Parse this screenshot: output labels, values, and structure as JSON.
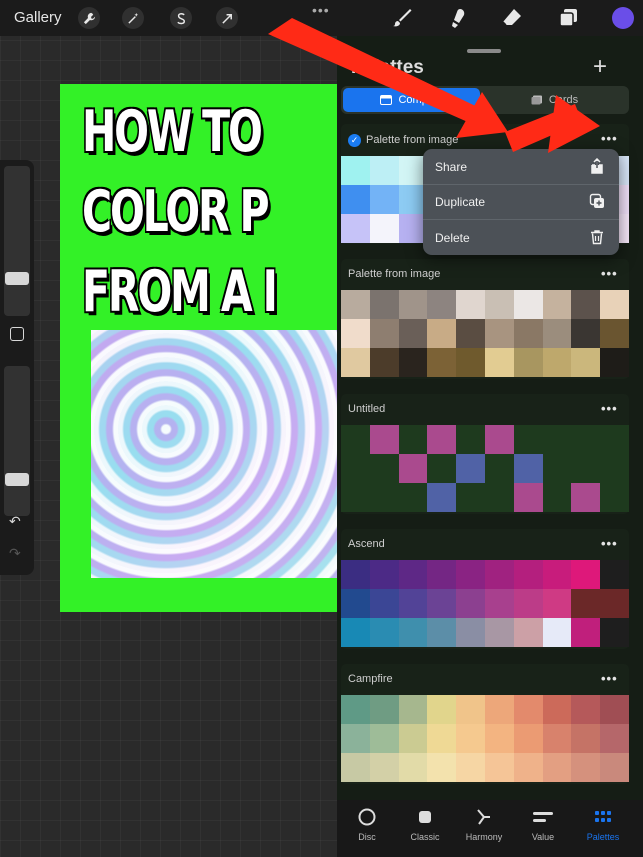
{
  "topbar": {
    "gallery_label": "Gallery",
    "tools": [
      "wrench-icon",
      "magic-wand-icon",
      "selection-icon",
      "transform-arrow-icon"
    ],
    "right_tools": [
      "brush-icon",
      "smudge-icon",
      "eraser-icon",
      "layers-icon",
      "color-swatch"
    ],
    "more_label": "•••",
    "active_color": "#6a4ee8"
  },
  "canvas": {
    "background_color": "#33f127",
    "headline_lines": [
      "HOW TO",
      "COLOR P",
      "FROM A I"
    ]
  },
  "panel": {
    "title": "Palettes",
    "add_label": "+",
    "segments": {
      "compact_label": "Compact",
      "cards_label": "Cards",
      "selected": "Compact"
    },
    "more_label": "•••",
    "palettes": [
      {
        "name": "Palette from image",
        "is_default": true,
        "default_mark": "✓",
        "swatches": [
          "#9ff2f0",
          "#bdeff5",
          "#d2f5f5",
          "#e2f4f7",
          "#f3f6f8",
          "#e9e9f7",
          "#d9d6f3",
          "#ccc9f1",
          "#c5c6f5",
          "#d8e6f8",
          "#3f8ff0",
          "#73b3f6",
          "#8dcbf3",
          "#a8d3f4",
          "#b8c6f1",
          "#c6b7ef",
          "#d2b7f0",
          "#e1c1f1",
          "#e4c8f3",
          "#f0dff8",
          "#c6c3f8",
          "#f4f4fb",
          "#b6b1f1",
          "#a4a7ed",
          "#a7b8f0",
          "#c2c6f2",
          "#d4c2f2",
          "#e6cdf4",
          "#eed7f5",
          "#f6e6f9"
        ]
      },
      {
        "name": "Palette from image",
        "is_default": false,
        "swatches": [
          "#b8ab9e",
          "#7b736e",
          "#a0948a",
          "#8d8480",
          "#e0d6cf",
          "#c9bfb4",
          "#ebe7e5",
          "#c5b29e",
          "#5c524c",
          "#e8d2b8",
          "#f0dccb",
          "#8e7e70",
          "#6a5f58",
          "#c8ab86",
          "#5a4d42",
          "#a89480",
          "#8a7865",
          "#9b8d7d",
          "#3a3632",
          "#6a5530",
          "#e0c9a0",
          "#4c3c2a",
          "#2a241e",
          "#7c6236",
          "#6f5a2d",
          "#e2cc92",
          "#a89660",
          "#bea86c",
          "#cbb77c",
          "#1e1c18"
        ]
      },
      {
        "name": "Untitled",
        "is_default": false,
        "swatches": [
          "#1e3a1e",
          "#aa4a8e",
          "#1e3a1e",
          "#aa4a8e",
          "#1e3a1e",
          "#aa4a8e",
          "#1e3a1e",
          "#1e3a1e",
          "#1e3a1e",
          "#1e3a1e",
          "#1e3a1e",
          "#1e3a1e",
          "#aa4a8e",
          "#1e3a1e",
          "#5062a6",
          "#1e3a1e",
          "#5062a6",
          "#1e3a1e",
          "#1e3a1e",
          "#1e3a1e",
          "#1e3a1e",
          "#1e3a1e",
          "#1e3a1e",
          "#5062a6",
          "#1e3a1e",
          "#1e3a1e",
          "#aa4a8e",
          "#1e3a1e",
          "#aa4a8e",
          "#1e3a1e"
        ]
      },
      {
        "name": "Ascend",
        "is_default": false,
        "swatches": [
          "#3b2d82",
          "#4c2a86",
          "#5e2886",
          "#742684",
          "#8a2383",
          "#a02280",
          "#b41f7e",
          "#c81c7c",
          "#de187a",
          "#1e1e1e",
          "#224a8f",
          "#3b4695",
          "#524397",
          "#6b4395",
          "#8c4090",
          "#a8408e",
          "#bc3c88",
          "#cf3a84",
          "#6b2828",
          "#6b2828",
          "#1889b5",
          "#2a8cb2",
          "#3f8fad",
          "#5c8ea8",
          "#8a8ea4",
          "#a897a4",
          "#cca0a6",
          "#e6eaf8",
          "#c01f7c",
          "#1e1e1e"
        ]
      },
      {
        "name": "Campfire",
        "is_default": false,
        "swatches": [
          "#5f9a86",
          "#6f9c83",
          "#a6b78e",
          "#e1d58c",
          "#f0c48a",
          "#eda77a",
          "#e38a6c",
          "#cc6a5a",
          "#b5595a",
          "#a04e54",
          "#8bb29a",
          "#9ebc98",
          "#cbcb92",
          "#efd995",
          "#f5c98f",
          "#f3b481",
          "#eb9b73",
          "#d8826c",
          "#c57366",
          "#b5676a",
          "#c7c9a4",
          "#d3d0a7",
          "#e2dba8",
          "#f3e2ad",
          "#f6d6a4",
          "#f5c597",
          "#efb28a",
          "#e39f82",
          "#d5917d",
          "#c9897c"
        ]
      }
    ]
  },
  "context_menu": {
    "items": [
      {
        "label": "Share",
        "icon": "share-icon"
      },
      {
        "label": "Duplicate",
        "icon": "duplicate-icon"
      },
      {
        "label": "Delete",
        "icon": "trash-icon"
      }
    ]
  },
  "bottom_nav": {
    "items": [
      {
        "label": "Disc",
        "icon": "disc-icon",
        "active": false
      },
      {
        "label": "Classic",
        "icon": "classic-icon",
        "active": false
      },
      {
        "label": "Harmony",
        "icon": "harmony-icon",
        "active": false
      },
      {
        "label": "Value",
        "icon": "value-icon",
        "active": false
      },
      {
        "label": "Palettes",
        "icon": "palettes-icon",
        "active": true
      }
    ],
    "active_color": "#1a74ee"
  },
  "annotation_color": "#ff2a16"
}
